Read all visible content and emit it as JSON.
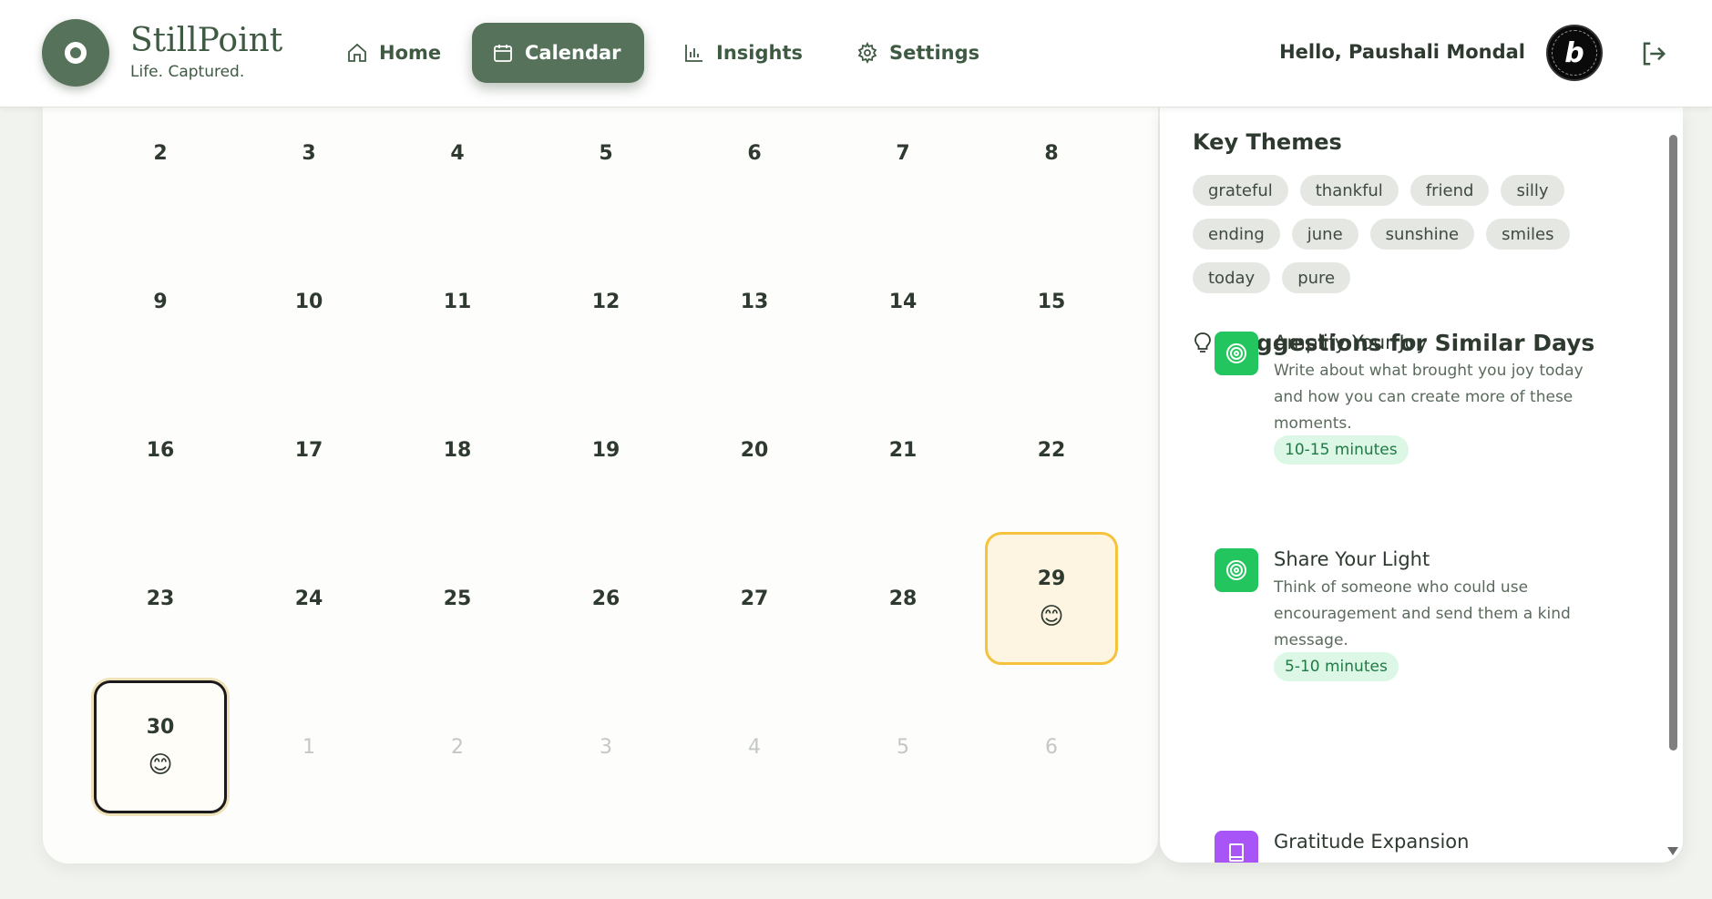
{
  "brand": {
    "name": "StillPoint",
    "tagline": "Life. Captured."
  },
  "nav": {
    "home": "Home",
    "calendar": "Calendar",
    "insights": "Insights",
    "settings": "Settings"
  },
  "user": {
    "greeting": "Hello, Paushali Mondal",
    "avatar_letter": "b"
  },
  "calendar": {
    "weeks": [
      [
        "2",
        "3",
        "4",
        "5",
        "6",
        "7",
        "8"
      ],
      [
        "9",
        "10",
        "11",
        "12",
        "13",
        "14",
        "15"
      ],
      [
        "16",
        "17",
        "18",
        "19",
        "20",
        "21",
        "22"
      ],
      [
        "23",
        "24",
        "25",
        "26",
        "27",
        "28",
        "29"
      ],
      [
        "30",
        "1",
        "2",
        "3",
        "4",
        "5",
        "6"
      ]
    ],
    "mood_emoji": "😊",
    "entries": [
      "29",
      "30"
    ],
    "today": "30",
    "next_month_days": [
      "1",
      "2",
      "3",
      "4",
      "5",
      "6"
    ]
  },
  "insights": {
    "key_themes_title": "Key Themes",
    "themes": [
      "grateful",
      "thankful",
      "friend",
      "silly",
      "ending",
      "june",
      "sunshine",
      "smiles",
      "today",
      "pure"
    ],
    "suggestions_title": "Suggestions for Similar Days",
    "suggestions": [
      {
        "title": "Amplify Your Joy",
        "description": "Write about what brought you joy today and how you can create more of these moments.",
        "duration": "10-15 minutes",
        "icon": "target-icon",
        "color": "#22c55e"
      },
      {
        "title": "Share Your Light",
        "description": "Think of someone who could use encouragement and send them a kind message.",
        "duration": "5-10 minutes",
        "icon": "target-icon",
        "color": "#22c55e"
      },
      {
        "title": "Gratitude Expansion",
        "description": "",
        "duration": "",
        "icon": "book-icon",
        "color": "#a855f7"
      }
    ]
  },
  "colors": {
    "brand_green": "#57725a",
    "entry_highlight": "#f5c23c",
    "today_border": "#1a1a1a"
  }
}
